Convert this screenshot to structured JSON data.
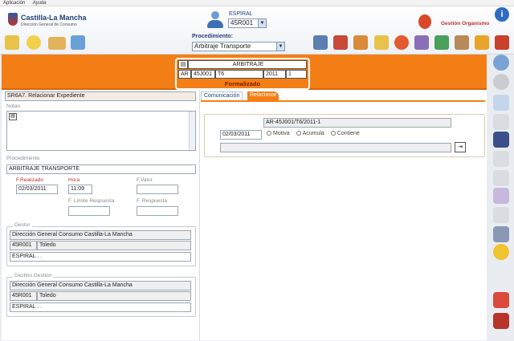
{
  "menu": {
    "items": [
      "Aplicación",
      "Ayuda"
    ]
  },
  "header": {
    "brand": "Castilla-La Mancha",
    "brand_sub": "Dirección General de Consumo",
    "user_label": "ESPIRAL",
    "user_select": "45R001",
    "procedimiento_label": "Procedimiento:",
    "procedimiento_select": "Arbitraje Transporte",
    "gestion_label": "Gestión Organismo"
  },
  "case": {
    "title": "ARBITRAJE",
    "c1": "AR",
    "c2": "45J001",
    "c3": "T6",
    "c4": "2011",
    "c5": "1",
    "status": "Formalizado"
  },
  "left": {
    "heading": "SR6A7. Relacionar Expediente",
    "notas_label": "Notas",
    "procedimiento_label": "Procedimiento",
    "procedimiento_value": "ARBITRAJE TRANSPORTE",
    "f_realizado_label": "F.Realizado",
    "f_realizado_value": "02/03/2011",
    "hora_label": "Hora",
    "hora_value": "11:09",
    "f_valor_label": "F.Valor",
    "f_limite_label": "F. Límite Respuesta",
    "f_respuesta_label": "F. Respuesta",
    "gestor_label": "Gestor",
    "gestor_org": "Dirección General Consumo Castilla-La Mancha",
    "gestor_code": "45R001",
    "gestor_city": "Toledo",
    "gestor_user": "ESPIRAL . .",
    "destino_label": "Destino Gestión",
    "destino_org": "Dirección General Consumo Castilla-La Mancha",
    "destino_code": "45R001",
    "destino_city": "Toledo",
    "destino_user": "ESPIRAL . ."
  },
  "right": {
    "tab_comunicacion": "Comunicación",
    "tab_relacionar": "Relacionar",
    "expediente": "AR-45J001/T6/2011-1",
    "fecha": "02/03/2011",
    "radio_motiva": "Motiva",
    "radio_acumula": "Acumula",
    "radio_contiene": "Contiene"
  },
  "colors": {
    "accent": "#f47e16",
    "brand_blue": "#1f3f7a"
  }
}
